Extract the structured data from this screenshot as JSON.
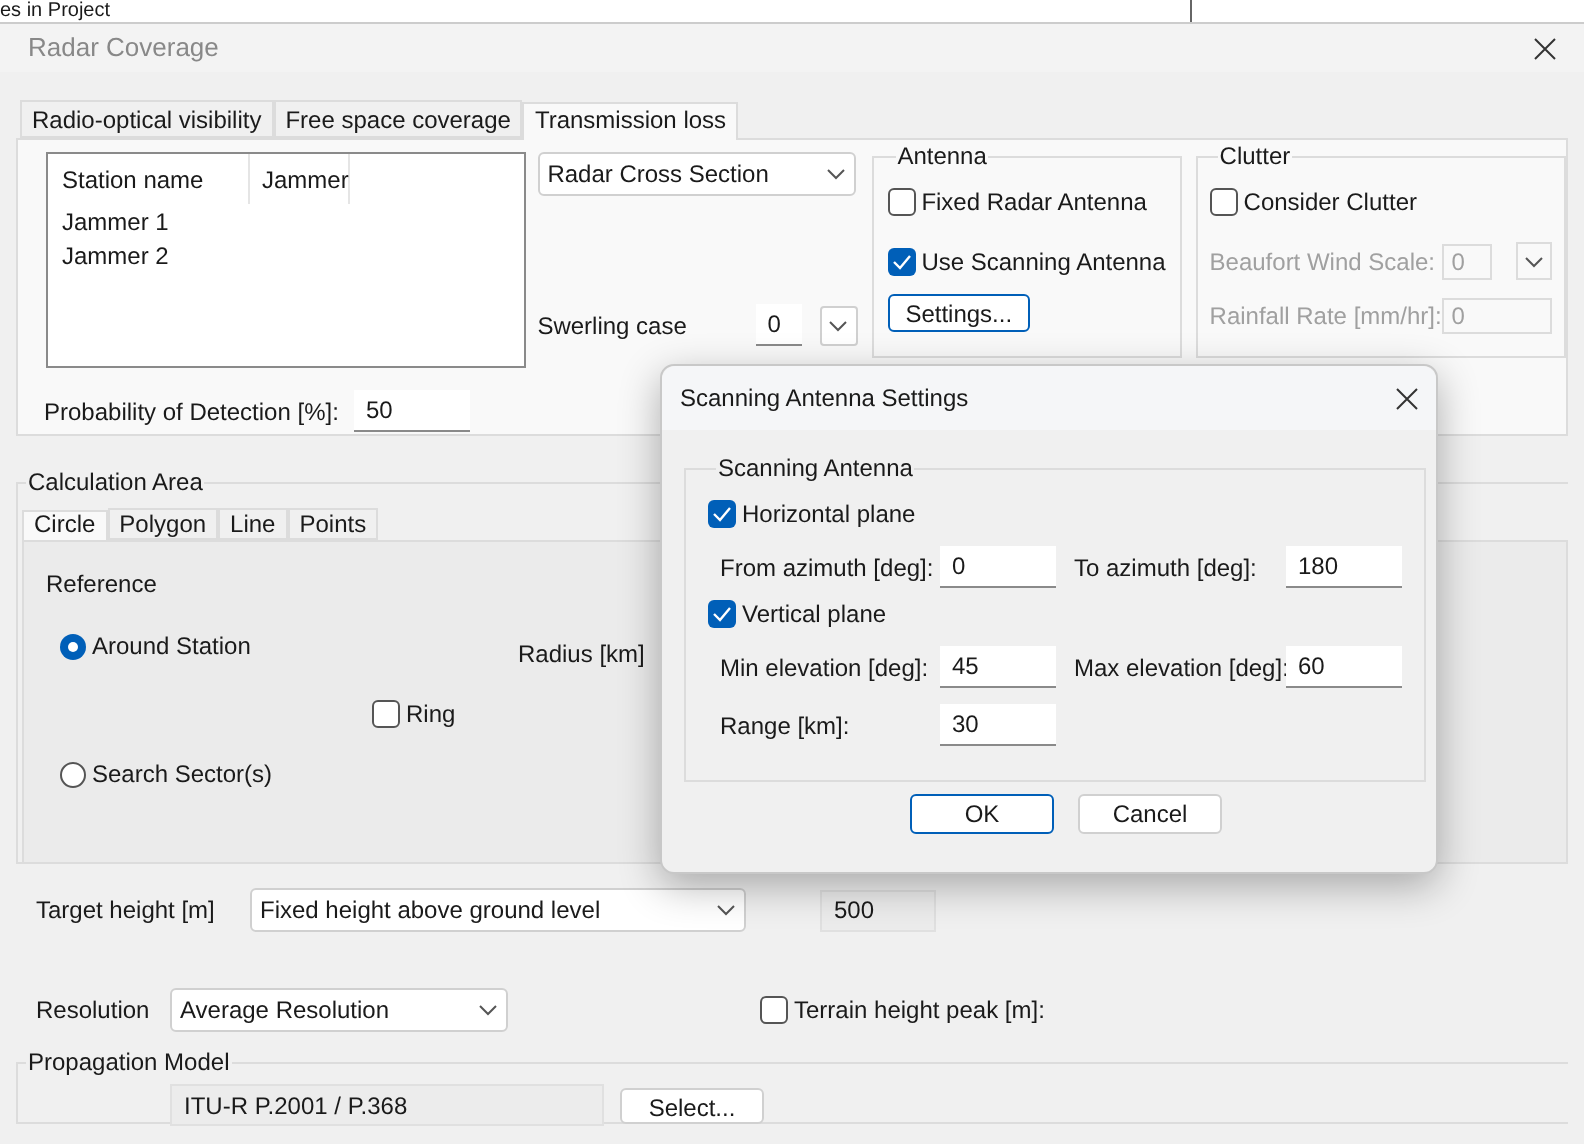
{
  "background_window": {
    "text": "es in Project"
  },
  "window": {
    "title": "Radar Coverage"
  },
  "tabs": [
    {
      "label": "Radio-optical visibility",
      "selected": false
    },
    {
      "label": "Free space coverage",
      "selected": false
    },
    {
      "label": "Transmission loss",
      "selected": true
    }
  ],
  "stations": {
    "columns": [
      "Station name",
      "Jammer"
    ],
    "rows": [
      "Jammer 1",
      "Jammer 2"
    ]
  },
  "rcs_dropdown": {
    "value": "Radar Cross Section"
  },
  "swerling": {
    "label": "Swerling case",
    "value": "0"
  },
  "antenna": {
    "title": "Antenna",
    "options": [
      {
        "label": "Fixed Radar Antenna",
        "checked": false
      },
      {
        "label": "Use Scanning Antenna",
        "checked": true
      }
    ],
    "button": "Settings..."
  },
  "clutter": {
    "title": "Clutter",
    "consider": {
      "label": "Consider Clutter",
      "checked": false
    },
    "disabled": true,
    "fields": [
      {
        "label": "Beaufort Wind Scale:",
        "value": "0",
        "kind": "dropdown"
      },
      {
        "label": "Rainfall Rate [mm/hr]:",
        "value": "0",
        "kind": "text"
      }
    ]
  },
  "probability": {
    "label": "Probability of Detection [%]:",
    "value": "50"
  },
  "calculation_area": {
    "title": "Calculation Area",
    "tabs": [
      {
        "label": "Circle",
        "selected": true
      },
      {
        "label": "Polygon",
        "selected": false
      },
      {
        "label": "Line",
        "selected": false
      },
      {
        "label": "Points",
        "selected": false
      }
    ],
    "reference": "Reference",
    "options": [
      {
        "label": "Around Station",
        "selected": true
      },
      {
        "label": "Search Sector(s)",
        "selected": false
      }
    ],
    "radius_label": "Radius [km]",
    "ring": {
      "label": "Ring",
      "checked": false
    }
  },
  "target_height": {
    "label": "Target height [m]",
    "mode": "Fixed height above ground level",
    "value": "500"
  },
  "resolution": {
    "label": "Resolution",
    "value": "Average Resolution"
  },
  "terrain_peak": {
    "label": "Terrain height peak [m]:",
    "checked": false
  },
  "propagation": {
    "title": "Propagation Model",
    "value": "ITU-R P.2001 / P.368",
    "button": "Select..."
  },
  "dialog": {
    "title": "Scanning Antenna Settings",
    "group": "Scanning Antenna",
    "sections": [
      {
        "label": "Horizontal plane",
        "checked": true,
        "fields": [
          {
            "label": "From azimuth [deg]:",
            "value": "0"
          },
          {
            "label": "To azimuth [deg]:",
            "value": "180"
          }
        ]
      },
      {
        "label": "Vertical plane",
        "checked": true,
        "fields": [
          {
            "label": "Min elevation [deg]:",
            "value": "45"
          },
          {
            "label": "Max elevation [deg]:",
            "value": "60"
          }
        ]
      }
    ],
    "range": {
      "label": "Range [km]:",
      "value": "30"
    },
    "buttons": [
      "OK",
      "Cancel"
    ]
  }
}
